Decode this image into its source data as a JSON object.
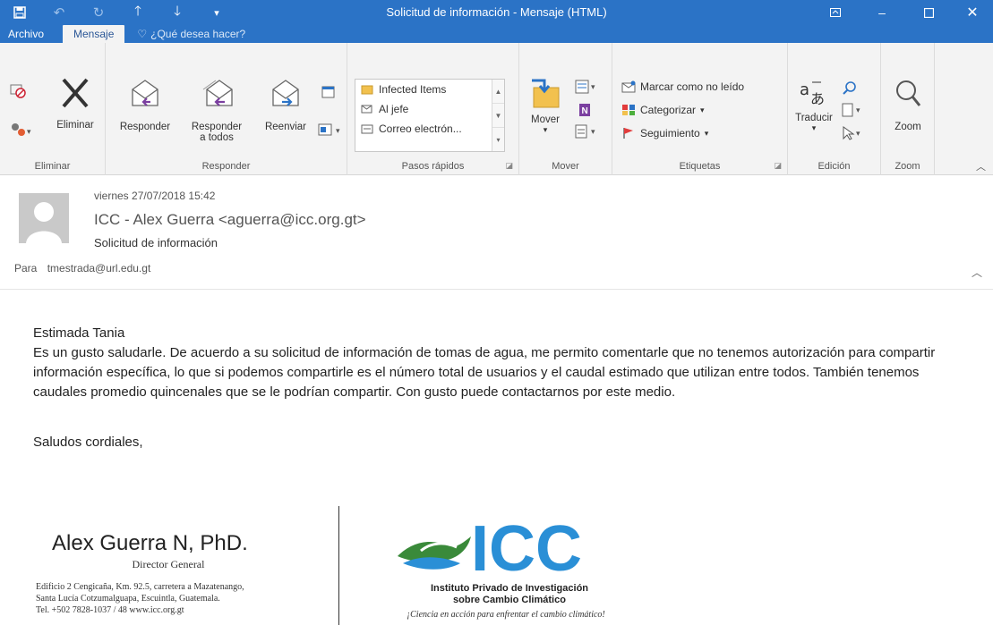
{
  "window": {
    "title": "Solicitud de información  -  Mensaje (HTML)",
    "tabs": [
      "Archivo",
      "Mensaje"
    ],
    "tell_me": "¿Qué desea hacer?"
  },
  "ribbon": {
    "groups": {
      "delete": {
        "label": "Eliminar",
        "delete_button": "Eliminar"
      },
      "respond": {
        "label": "Responder",
        "reply": "Responder",
        "reply_all_line1": "Responder",
        "reply_all_line2": "a todos",
        "forward": "Reenviar"
      },
      "quick_steps": {
        "label": "Pasos rápidos",
        "items": [
          "Infected Items",
          "Al jefe",
          "Correo electrón..."
        ]
      },
      "move": {
        "label": "Mover",
        "move_button": "Mover"
      },
      "tags": {
        "label": "Etiquetas",
        "mark_unread": "Marcar como no leído",
        "categorize": "Categorizar",
        "follow_up": "Seguimiento"
      },
      "editing": {
        "label": "Edición",
        "translate": "Traducir"
      },
      "zoom": {
        "label": "Zoom",
        "zoom_button": "Zoom"
      }
    }
  },
  "message": {
    "date": "viernes 27/07/2018 15:42",
    "from": "ICC - Alex Guerra <aguerra@icc.org.gt>",
    "subject": "Solicitud de información",
    "to_label": "Para",
    "to": "tmestrada@url.edu.gt",
    "greeting": "Estimada Tania",
    "body": "Es un gusto saludarle. De acuerdo a su solicitud de información de tomas de agua, me permito comentarle que no tenemos autorización para compartir información específica, lo que si podemos compartirle es el número total de usuarios y el caudal estimado que utilizan entre todos. También tenemos caudales promedio quincenales que se le podrían compartir. Con gusto puede contactarnos por este medio.",
    "closing": "Saludos cordiales,"
  },
  "signature": {
    "name": "Alex Guerra N, PhD.",
    "title": "Director General",
    "address_line1": "Edificio 2 Cengicaña, Km. 92.5, carretera a Mazatenango,",
    "address_line2": "Santa Lucía Cotzumalguapa, Escuintla, Guatemala.",
    "address_line3": "Tel. +502 7828-1037 / 48 www.icc.org.gt",
    "logo_text": "ICC",
    "org_line1": "Instituto Privado de Investigación",
    "org_line2": "sobre Cambio Climático",
    "tagline": "¡Ciencia en acción para enfrentar el cambio climático!"
  },
  "colors": {
    "title_bar": "#2b73c6",
    "ribbon": "#f3f3f3",
    "logo_blue": "#2a8fd6",
    "logo_green": "#4caf3c"
  }
}
